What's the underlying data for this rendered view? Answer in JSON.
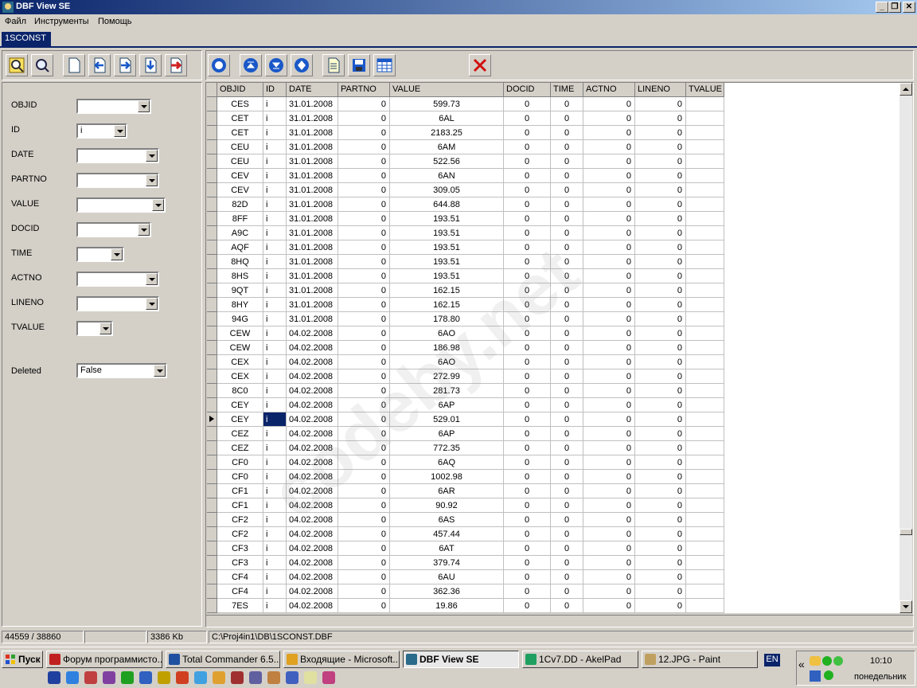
{
  "window": {
    "title": "DBF View SE"
  },
  "menu": [
    "Файл",
    "Инструменты",
    "Помощь"
  ],
  "tab": "1SCONST",
  "filters": [
    {
      "label": "OBJID",
      "value": ""
    },
    {
      "label": "ID",
      "value": "i"
    },
    {
      "label": "DATE",
      "value": ""
    },
    {
      "label": "PARTNO",
      "value": ""
    },
    {
      "label": "VALUE",
      "value": ""
    },
    {
      "label": "DOCID",
      "value": ""
    },
    {
      "label": "TIME",
      "value": ""
    },
    {
      "label": "ACTNO",
      "value": ""
    },
    {
      "label": "LINENO",
      "value": ""
    },
    {
      "label": "TVALUE",
      "value": ""
    }
  ],
  "deleted": {
    "label": "Deleted",
    "value": "False"
  },
  "columns": [
    "OBJID",
    "ID",
    "DATE",
    "PARTNO",
    "VALUE",
    "DOCID",
    "TIME",
    "ACTNO",
    "LINENO",
    "TVALUE"
  ],
  "rows": [
    [
      "CES",
      "i",
      "31.01.2008",
      "0",
      "599.73",
      "0",
      "0",
      "0",
      "0",
      ""
    ],
    [
      "CET",
      "i",
      "31.01.2008",
      "0",
      "6AL",
      "0",
      "0",
      "0",
      "0",
      ""
    ],
    [
      "CET",
      "i",
      "31.01.2008",
      "0",
      "2183.25",
      "0",
      "0",
      "0",
      "0",
      ""
    ],
    [
      "CEU",
      "i",
      "31.01.2008",
      "0",
      "6AM",
      "0",
      "0",
      "0",
      "0",
      ""
    ],
    [
      "CEU",
      "i",
      "31.01.2008",
      "0",
      "522.56",
      "0",
      "0",
      "0",
      "0",
      ""
    ],
    [
      "CEV",
      "i",
      "31.01.2008",
      "0",
      "6AN",
      "0",
      "0",
      "0",
      "0",
      ""
    ],
    [
      "CEV",
      "i",
      "31.01.2008",
      "0",
      "309.05",
      "0",
      "0",
      "0",
      "0",
      ""
    ],
    [
      "82D",
      "i",
      "31.01.2008",
      "0",
      "644.88",
      "0",
      "0",
      "0",
      "0",
      ""
    ],
    [
      "8FF",
      "i",
      "31.01.2008",
      "0",
      "193.51",
      "0",
      "0",
      "0",
      "0",
      ""
    ],
    [
      "A9C",
      "i",
      "31.01.2008",
      "0",
      "193.51",
      "0",
      "0",
      "0",
      "0",
      ""
    ],
    [
      "AQF",
      "i",
      "31.01.2008",
      "0",
      "193.51",
      "0",
      "0",
      "0",
      "0",
      ""
    ],
    [
      "8HQ",
      "i",
      "31.01.2008",
      "0",
      "193.51",
      "0",
      "0",
      "0",
      "0",
      ""
    ],
    [
      "8HS",
      "i",
      "31.01.2008",
      "0",
      "193.51",
      "0",
      "0",
      "0",
      "0",
      ""
    ],
    [
      "9QT",
      "i",
      "31.01.2008",
      "0",
      "162.15",
      "0",
      "0",
      "0",
      "0",
      ""
    ],
    [
      "8HY",
      "i",
      "31.01.2008",
      "0",
      "162.15",
      "0",
      "0",
      "0",
      "0",
      ""
    ],
    [
      "94G",
      "i",
      "31.01.2008",
      "0",
      "178.80",
      "0",
      "0",
      "0",
      "0",
      ""
    ],
    [
      "CEW",
      "i",
      "04.02.2008",
      "0",
      "6AO",
      "0",
      "0",
      "0",
      "0",
      ""
    ],
    [
      "CEW",
      "i",
      "04.02.2008",
      "0",
      "186.98",
      "0",
      "0",
      "0",
      "0",
      ""
    ],
    [
      "CEX",
      "i",
      "04.02.2008",
      "0",
      "6AO",
      "0",
      "0",
      "0",
      "0",
      ""
    ],
    [
      "CEX",
      "i",
      "04.02.2008",
      "0",
      "272.99",
      "0",
      "0",
      "0",
      "0",
      ""
    ],
    [
      "8C0",
      "i",
      "04.02.2008",
      "0",
      "281.73",
      "0",
      "0",
      "0",
      "0",
      ""
    ],
    [
      "CEY",
      "i",
      "04.02.2008",
      "0",
      "6AP",
      "0",
      "0",
      "0",
      "0",
      ""
    ],
    [
      "CEY",
      "i",
      "04.02.2008",
      "0",
      "529.01",
      "0",
      "0",
      "0",
      "0",
      ""
    ],
    [
      "CEZ",
      "i",
      "04.02.2008",
      "0",
      "6AP",
      "0",
      "0",
      "0",
      "0",
      ""
    ],
    [
      "CEZ",
      "i",
      "04.02.2008",
      "0",
      "772.35",
      "0",
      "0",
      "0",
      "0",
      ""
    ],
    [
      "CF0",
      "i",
      "04.02.2008",
      "0",
      "6AQ",
      "0",
      "0",
      "0",
      "0",
      ""
    ],
    [
      "CF0",
      "i",
      "04.02.2008",
      "0",
      "1002.98",
      "0",
      "0",
      "0",
      "0",
      ""
    ],
    [
      "CF1",
      "i",
      "04.02.2008",
      "0",
      "6AR",
      "0",
      "0",
      "0",
      "0",
      ""
    ],
    [
      "CF1",
      "i",
      "04.02.2008",
      "0",
      "90.92",
      "0",
      "0",
      "0",
      "0",
      ""
    ],
    [
      "CF2",
      "i",
      "04.02.2008",
      "0",
      "6AS",
      "0",
      "0",
      "0",
      "0",
      ""
    ],
    [
      "CF2",
      "i",
      "04.02.2008",
      "0",
      "457.44",
      "0",
      "0",
      "0",
      "0",
      ""
    ],
    [
      "CF3",
      "i",
      "04.02.2008",
      "0",
      "6AT",
      "0",
      "0",
      "0",
      "0",
      ""
    ],
    [
      "CF3",
      "i",
      "04.02.2008",
      "0",
      "379.74",
      "0",
      "0",
      "0",
      "0",
      ""
    ],
    [
      "CF4",
      "i",
      "04.02.2008",
      "0",
      "6AU",
      "0",
      "0",
      "0",
      "0",
      ""
    ],
    [
      "CF4",
      "i",
      "04.02.2008",
      "0",
      "362.36",
      "0",
      "0",
      "0",
      "0",
      ""
    ],
    [
      "7ES",
      "i",
      "04.02.2008",
      "0",
      "19.86",
      "0",
      "0",
      "0",
      "0",
      ""
    ]
  ],
  "current_row": 22,
  "status": {
    "records": "44559 / 38860",
    "blank": "",
    "size": "3386 Kb",
    "path": "C:\\Proj4in1\\DB\\1SCONST.DBF"
  },
  "taskbar": {
    "start": "Пуск",
    "tasks": [
      "Форум программисто...",
      "Total Commander 6.5...",
      "Входящие - Microsoft...",
      "DBF View SE",
      "1Cv7.DD - AkelPad",
      "12.JPG - Paint"
    ],
    "active_task": 3,
    "lang": "EN",
    "clock": "10:10",
    "day": "понедельник"
  },
  "watermark": "codeby.net",
  "colors": {
    "title_start": "#0a246a",
    "title_end": "#a6caf0",
    "selection": "#0a246a"
  }
}
